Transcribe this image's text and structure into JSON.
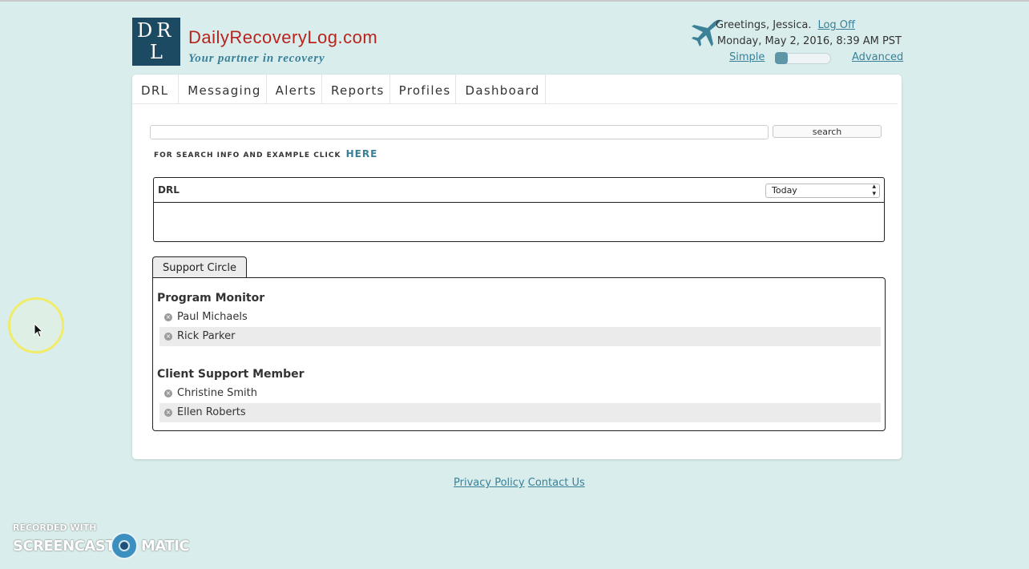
{
  "header": {
    "logo_line1": "DR",
    "logo_line2": "L",
    "site_name": "DailyRecoveryLog.com",
    "tagline": "Your partner in recovery",
    "greeting": "Greetings, Jessica.",
    "logoff_label": "Log Off",
    "datetime": "Monday, May 2, 2016, 8:39 AM PST",
    "mode_simple": "Simple",
    "mode_advanced": "Advanced",
    "mode_level": 0
  },
  "nav": {
    "items": [
      "DRL",
      "Messaging",
      "Alerts",
      "Reports",
      "Profiles",
      "Dashboard"
    ]
  },
  "search": {
    "value": "",
    "button_label": "search",
    "info_text": "FOR SEARCH INFO AND EXAMPLE CLICK",
    "info_link": "HERE"
  },
  "drl_panel": {
    "title": "DRL",
    "period_selected": "Today"
  },
  "support_circle": {
    "tab_label": "Support Circle",
    "groups": [
      {
        "title": "Program Monitor",
        "members": [
          "Paul Michaels",
          "Rick Parker"
        ]
      },
      {
        "title": "Client Support Member",
        "members": [
          "Christine Smith",
          "Ellen Roberts"
        ]
      }
    ]
  },
  "footer": {
    "privacy": "Privacy Policy",
    "contact": "Contact Us"
  },
  "watermark": {
    "line1": "RECORDED WITH",
    "left_word": "SCREENCAST",
    "right_word": "MATIC"
  },
  "colors": {
    "background": "#d9eeec",
    "brand_red": "#b8231e",
    "brand_blue": "#3a7f98",
    "logo_bg": "#1d4a63"
  }
}
